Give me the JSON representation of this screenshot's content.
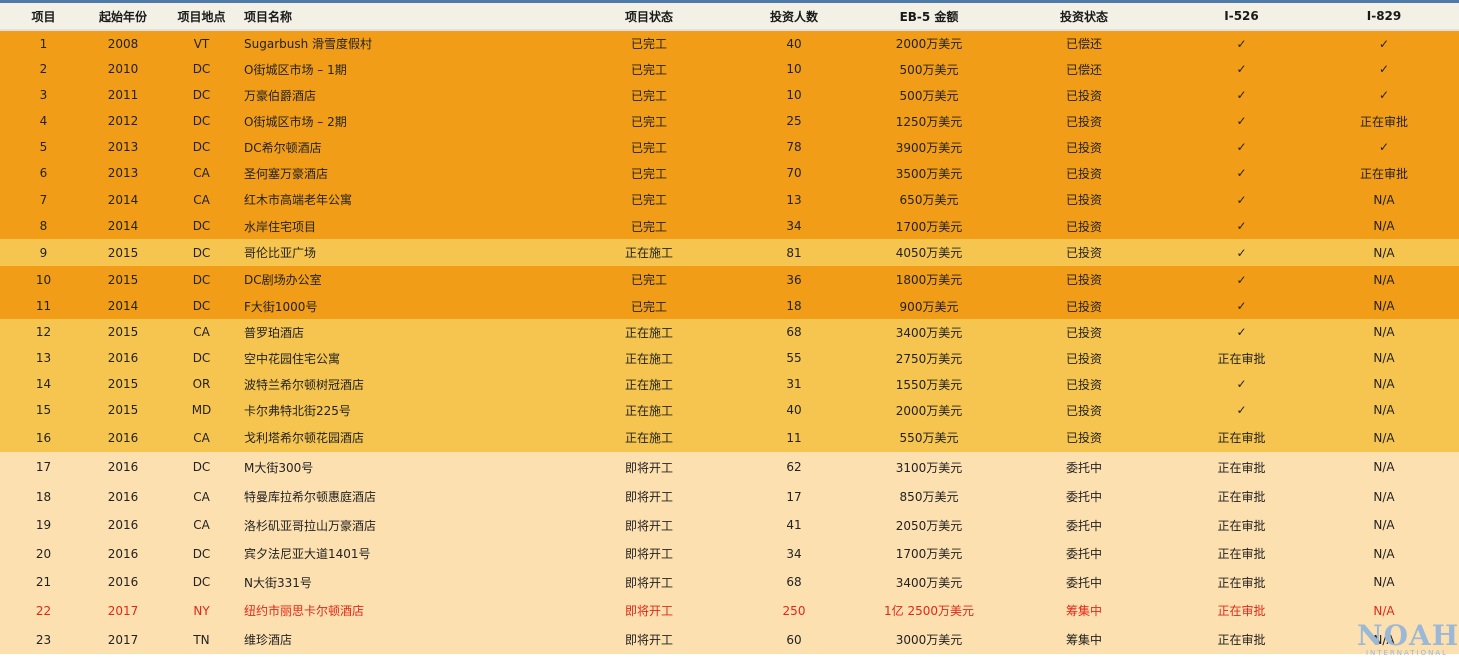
{
  "headers": [
    "项目",
    "起始年份",
    "项目地点",
    "项目名称",
    "项目状态",
    "投资人数",
    "EB-5 金额",
    "投资状态",
    "I-526",
    "I-829"
  ],
  "rows": [
    {
      "no": "1",
      "year": "2008",
      "loc": "VT",
      "name": "Sugarbush 滑雪度假村",
      "status": "已完工",
      "investors": "40",
      "amount": "2000万美元",
      "invest_status": "已偿还",
      "i526": "✓",
      "i829": "✓",
      "group": "done"
    },
    {
      "no": "2",
      "year": "2010",
      "loc": "DC",
      "name": "O街城区市场 – 1期",
      "status": "已完工",
      "investors": "10",
      "amount": "500万美元",
      "invest_status": "已偿还",
      "i526": "✓",
      "i829": "✓",
      "group": "done"
    },
    {
      "no": "3",
      "year": "2011",
      "loc": "DC",
      "name": "万豪伯爵酒店",
      "status": "已完工",
      "investors": "10",
      "amount": "500万美元",
      "invest_status": "已投资",
      "i526": "✓",
      "i829": "✓",
      "group": "done"
    },
    {
      "no": "4",
      "year": "2012",
      "loc": "DC",
      "name": "O街城区市场 – 2期",
      "status": "已完工",
      "investors": "25",
      "amount": "1250万美元",
      "invest_status": "已投资",
      "i526": "✓",
      "i829": "正在审批",
      "group": "done"
    },
    {
      "no": "5",
      "year": "2013",
      "loc": "DC",
      "name": "DC希尔顿酒店",
      "status": "已完工",
      "investors": "78",
      "amount": "3900万美元",
      "invest_status": "已投资",
      "i526": "✓",
      "i829": "✓",
      "group": "done"
    },
    {
      "no": "6",
      "year": "2013",
      "loc": "CA",
      "name": "圣何塞万豪酒店",
      "status": "已完工",
      "investors": "70",
      "amount": "3500万美元",
      "invest_status": "已投资",
      "i526": "✓",
      "i829": "正在审批",
      "group": "done"
    },
    {
      "no": "7",
      "year": "2014",
      "loc": "CA",
      "name": "红木市高端老年公寓",
      "status": "已完工",
      "investors": "13",
      "amount": "650万美元",
      "invest_status": "已投资",
      "i526": "✓",
      "i829": "N/A",
      "group": "done"
    },
    {
      "no": "8",
      "year": "2014",
      "loc": "DC",
      "name": "水岸住宅项目",
      "status": "已完工",
      "investors": "34",
      "amount": "1700万美元",
      "invest_status": "已投资",
      "i526": "✓",
      "i829": "N/A",
      "group": "done"
    },
    {
      "no": "9",
      "year": "2015",
      "loc": "DC",
      "name": "哥伦比亚广场",
      "status": "正在施工",
      "investors": "81",
      "amount": "4050万美元",
      "invest_status": "已投资",
      "i526": "✓",
      "i829": "N/A",
      "group": "build"
    },
    {
      "no": "10",
      "year": "2015",
      "loc": "DC",
      "name": "DC剧场办公室",
      "status": "已完工",
      "investors": "36",
      "amount": "1800万美元",
      "invest_status": "已投资",
      "i526": "✓",
      "i829": "N/A",
      "group": "done"
    },
    {
      "no": "11",
      "year": "2014",
      "loc": "DC",
      "name": "F大街1000号",
      "status": "已完工",
      "investors": "18",
      "amount": "900万美元",
      "invest_status": "已投资",
      "i526": "✓",
      "i829": "N/A",
      "group": "done"
    },
    {
      "no": "12",
      "year": "2015",
      "loc": "CA",
      "name": "普罗珀酒店",
      "status": "正在施工",
      "investors": "68",
      "amount": "3400万美元",
      "invest_status": "已投资",
      "i526": "✓",
      "i829": "N/A",
      "group": "build"
    },
    {
      "no": "13",
      "year": "2016",
      "loc": "DC",
      "name": "空中花园住宅公寓",
      "status": "正在施工",
      "investors": "55",
      "amount": "2750万美元",
      "invest_status": "已投资",
      "i526": "正在审批",
      "i829": "N/A",
      "group": "build"
    },
    {
      "no": "14",
      "year": "2015",
      "loc": "OR",
      "name": "波特兰希尔顿树冠酒店",
      "status": "正在施工",
      "investors": "31",
      "amount": "1550万美元",
      "invest_status": "已投资",
      "i526": "✓",
      "i829": "N/A",
      "group": "build"
    },
    {
      "no": "15",
      "year": "2015",
      "loc": "MD",
      "name": "卡尔弗特北街225号",
      "status": "正在施工",
      "investors": "40",
      "amount": "2000万美元",
      "invest_status": "已投资",
      "i526": "✓",
      "i829": "N/A",
      "group": "build"
    },
    {
      "no": "16",
      "year": "2016",
      "loc": "CA",
      "name": "戈利塔希尔顿花园酒店",
      "status": "正在施工",
      "investors": "11",
      "amount": "550万美元",
      "invest_status": "已投资",
      "i526": "正在审批",
      "i829": "N/A",
      "group": "build"
    },
    {
      "no": "17",
      "year": "2016",
      "loc": "DC",
      "name": " M大街300号",
      "status": "即将开工",
      "investors": "62",
      "amount": "3100万美元",
      "invest_status": "委托中",
      "i526": "正在审批",
      "i829": "N/A",
      "group": "soon"
    },
    {
      "no": "18",
      "year": "2016",
      "loc": "CA",
      "name": " 特曼库拉希尔顿惠庭酒店",
      "status": "即将开工",
      "investors": "17",
      "amount": "850万美元",
      "invest_status": "委托中",
      "i526": "正在审批",
      "i829": "N/A",
      "group": "soon"
    },
    {
      "no": "19",
      "year": "2016",
      "loc": "CA",
      "name": " 洛杉矶亚哥拉山万豪酒店",
      "status": "即将开工",
      "investors": "41",
      "amount": "2050万美元",
      "invest_status": "委托中",
      "i526": "正在审批",
      "i829": "N/A",
      "group": "soon"
    },
    {
      "no": "20",
      "year": "2016",
      "loc": "DC",
      "name": " 宾夕法尼亚大道1401号",
      "status": "即将开工",
      "investors": "34",
      "amount": "1700万美元",
      "invest_status": "委托中",
      "i526": "正在审批",
      "i829": "N/A",
      "group": "soon"
    },
    {
      "no": "21",
      "year": "2016",
      "loc": "DC",
      "name": " N大街331号",
      "status": "即将开工",
      "investors": "68",
      "amount": "3400万美元",
      "invest_status": "委托中",
      "i526": "正在审批",
      "i829": "N/A",
      "group": "soon"
    },
    {
      "no": "22",
      "year": "2017",
      "loc": "NY",
      "name": " 纽约市丽思卡尔顿酒店",
      "status": "即将开工",
      "investors": "250",
      "amount": "1亿 2500万美元",
      "invest_status": "筹集中",
      "i526": "正在审批",
      "i829": "N/A",
      "group": "soon",
      "highlight": "red"
    },
    {
      "no": "23",
      "year": "2017",
      "loc": "TN",
      "name": " 维珍酒店",
      "status": "即将开工",
      "investors": "60",
      "amount": "3000万美元",
      "invest_status": "筹集中",
      "i526": "正在审批",
      "i829": "N/A",
      "group": "soon"
    }
  ],
  "logo": {
    "big": "NOAH",
    "small": "INTERNATIONAL"
  },
  "colors": {
    "done": "#f29d17",
    "build": "#f6c54f",
    "soon": "#fde0b0",
    "highlight_red": "#e0281a",
    "header_bg": "#f3f0e6",
    "logo": "#9bb8d6"
  }
}
